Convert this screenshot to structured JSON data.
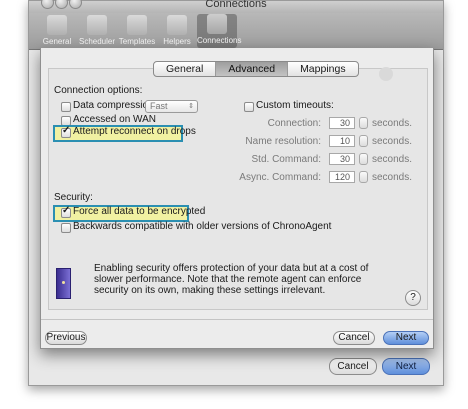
{
  "window": {
    "title": "Connections",
    "toolbar": [
      "General",
      "Scheduler",
      "Templates",
      "Helpers",
      "Connections"
    ]
  },
  "tabs": [
    "General",
    "Advanced",
    "Mappings"
  ],
  "connection_options": {
    "heading": "Connection options:",
    "data_compression_label": "Data compression:",
    "compression_value": "Fast",
    "accessed_on_wan": "Accessed on WAN",
    "attempt_reconnect": "Attempt reconnect on drops",
    "custom_timeouts": "Custom timeouts:"
  },
  "timeouts": [
    {
      "label": "Connection:",
      "value": "30",
      "unit": "seconds."
    },
    {
      "label": "Name resolution:",
      "value": "10",
      "unit": "seconds."
    },
    {
      "label": "Std. Command:",
      "value": "30",
      "unit": "seconds."
    },
    {
      "label": "Async. Command:",
      "value": "120",
      "unit": "seconds."
    }
  ],
  "security": {
    "heading": "Security:",
    "force_encrypt": "Force all data to be encrypted",
    "backwards_compat": "Backwards compatible with older versions of ChronoAgent"
  },
  "info_text": "Enabling security offers protection of your data but at a cost of slower performance. Note that the remote agent can enforce security on its own, making these settings irrelevant.",
  "help_symbol": "?",
  "buttons": {
    "previous": "Previous",
    "cancel": "Cancel",
    "next": "Next"
  },
  "colors": {
    "highlight_border": "#2b8fb2",
    "highlight_fill": "#f1f1a2",
    "primary_button": "#5f8fdb"
  }
}
